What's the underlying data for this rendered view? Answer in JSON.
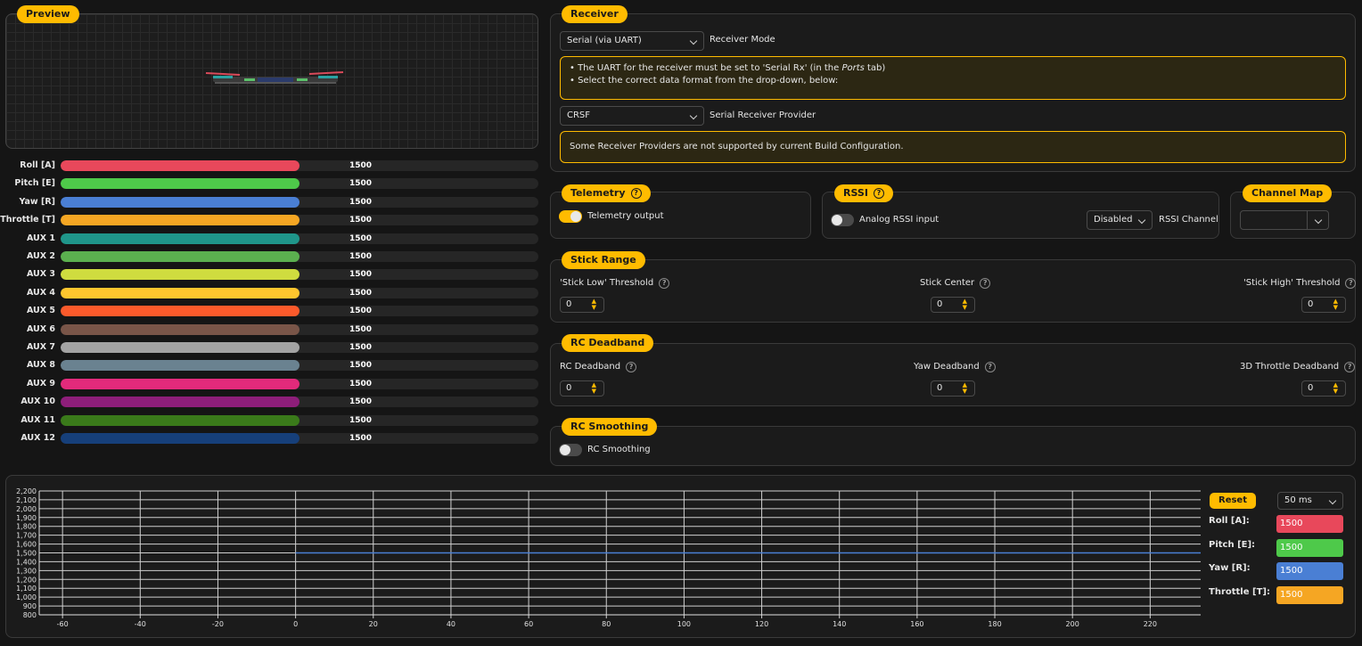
{
  "preview": {
    "title": "Preview"
  },
  "channels": [
    {
      "name": "Roll [A]",
      "value": "1500",
      "color": "#e8485b"
    },
    {
      "name": "Pitch [E]",
      "value": "1500",
      "color": "#4ec94a"
    },
    {
      "name": "Yaw [R]",
      "value": "1500",
      "color": "#4a7fd4"
    },
    {
      "name": "Throttle [T]",
      "value": "1500",
      "color": "#f5a623"
    },
    {
      "name": "AUX 1",
      "value": "1500",
      "color": "#1f968a"
    },
    {
      "name": "AUX 2",
      "value": "1500",
      "color": "#5bb04f"
    },
    {
      "name": "AUX 3",
      "value": "1500",
      "color": "#cfdc3f"
    },
    {
      "name": "AUX 4",
      "value": "1500",
      "color": "#ffc62e"
    },
    {
      "name": "AUX 5",
      "value": "1500",
      "color": "#fb5a2b"
    },
    {
      "name": "AUX 6",
      "value": "1500",
      "color": "#795548"
    },
    {
      "name": "AUX 7",
      "value": "1500",
      "color": "#a3a3a3"
    },
    {
      "name": "AUX 8",
      "value": "1500",
      "color": "#6a8290"
    },
    {
      "name": "AUX 9",
      "value": "1500",
      "color": "#e22a7b"
    },
    {
      "name": "AUX 10",
      "value": "1500",
      "color": "#8e1e7a"
    },
    {
      "name": "AUX 11",
      "value": "1500",
      "color": "#3a7a1a"
    },
    {
      "name": "AUX 12",
      "value": "1500",
      "color": "#163f7a"
    }
  ],
  "receiver": {
    "title": "Receiver",
    "mode_value": "Serial (via UART)",
    "mode_label": "Receiver Mode",
    "note1_line1_pre": "• The UART for the receiver must be set to 'Serial Rx' (in the ",
    "note1_line1_em": "Ports",
    "note1_line1_post": " tab)",
    "note1_line2": "• Select the correct data format from the drop-down, below:",
    "provider_value": "CRSF",
    "provider_label": "Serial Receiver Provider",
    "note2": "Some Receiver Providers are not supported by current Build Configuration."
  },
  "telemetry": {
    "title": "Telemetry",
    "toggle_label": "Telemetry output",
    "enabled": true
  },
  "rssi": {
    "title": "RSSI",
    "toggle_label": "Analog RSSI input",
    "enabled": false,
    "channel_value": "Disabled",
    "channel_label": "RSSI Channel"
  },
  "channel_map": {
    "title": "Channel Map",
    "value": ""
  },
  "stick_range": {
    "title": "Stick Range",
    "low_label": "'Stick Low' Threshold",
    "low_value": "0",
    "center_label": "Stick Center",
    "center_value": "0",
    "high_label": "'Stick High' Threshold",
    "high_value": "0"
  },
  "rc_deadband": {
    "title": "RC Deadband",
    "rc_label": "RC Deadband",
    "rc_value": "0",
    "yaw_label": "Yaw Deadband",
    "yaw_value": "0",
    "throttle_label": "3D Throttle Deadband",
    "throttle_value": "0"
  },
  "rc_smoothing": {
    "title": "RC Smoothing",
    "toggle_label": "RC Smoothing",
    "enabled": false
  },
  "graph": {
    "reset_label": "Reset",
    "interval_value": "50 ms",
    "legend": [
      {
        "label": "Roll [A]:",
        "value": "1500",
        "color": "#e8485b"
      },
      {
        "label": "Pitch [E]:",
        "value": "1500",
        "color": "#4ec94a"
      },
      {
        "label": "Yaw [R]:",
        "value": "1500",
        "color": "#4a7fd4"
      },
      {
        "label": "Throttle [T]:",
        "value": "1500",
        "color": "#f5a623"
      }
    ]
  },
  "chart_data": {
    "type": "line",
    "x_ticks": [
      "-60",
      "-40",
      "-20",
      "0",
      "20",
      "40",
      "60",
      "80",
      "100",
      "120",
      "140",
      "160",
      "180",
      "200",
      "220"
    ],
    "y_ticks": [
      "800",
      "900",
      "1,000",
      "1,100",
      "1,200",
      "1,300",
      "1,400",
      "1,500",
      "1,600",
      "1,700",
      "1,800",
      "1,900",
      "2,000",
      "2,100",
      "2,200"
    ],
    "xlim": [
      -66,
      233
    ],
    "ylim": [
      800,
      2200
    ],
    "grid": true,
    "series": [
      {
        "color": "#4a7fd4",
        "x": [
          0,
          233
        ],
        "y": [
          1500,
          1500
        ]
      }
    ]
  }
}
